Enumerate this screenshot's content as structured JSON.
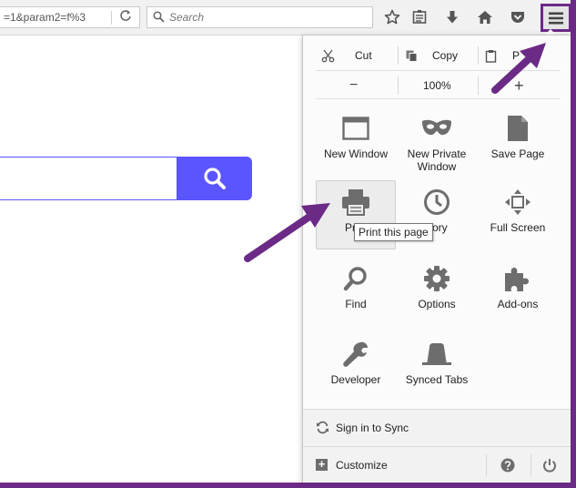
{
  "toolbar": {
    "url_text": "=1&param2=f%3",
    "search_placeholder": "Search"
  },
  "menu": {
    "edit": {
      "cut": "Cut",
      "copy": "Copy",
      "paste": "P"
    },
    "zoom": {
      "minus": "−",
      "level": "100%",
      "plus": "+"
    },
    "items": [
      {
        "label": "New Window",
        "icon": "new-window-icon"
      },
      {
        "label": "New Private\nWindow",
        "icon": "private-mask-icon"
      },
      {
        "label": "Save Page",
        "icon": "save-page-icon"
      },
      {
        "label": "Pr",
        "icon": "print-icon"
      },
      {
        "label": "ory",
        "icon": "history-clock-icon"
      },
      {
        "label": "Full Screen",
        "icon": "fullscreen-icon"
      },
      {
        "label": "Find",
        "icon": "magnifier-icon"
      },
      {
        "label": "Options",
        "icon": "gear-icon"
      },
      {
        "label": "Add-ons",
        "icon": "puzzle-icon"
      },
      {
        "label": "Developer",
        "icon": "wrench-icon"
      },
      {
        "label": "Synced Tabs",
        "icon": "synced-tabs-icon"
      }
    ],
    "sync_label": "Sign in to Sync",
    "customize_label": "Customize",
    "tooltip": "Print this page"
  },
  "colors": {
    "accent_purple": "#6b2a86",
    "page_button": "#5b55ff",
    "icon_gray": "#6d6d6d"
  }
}
